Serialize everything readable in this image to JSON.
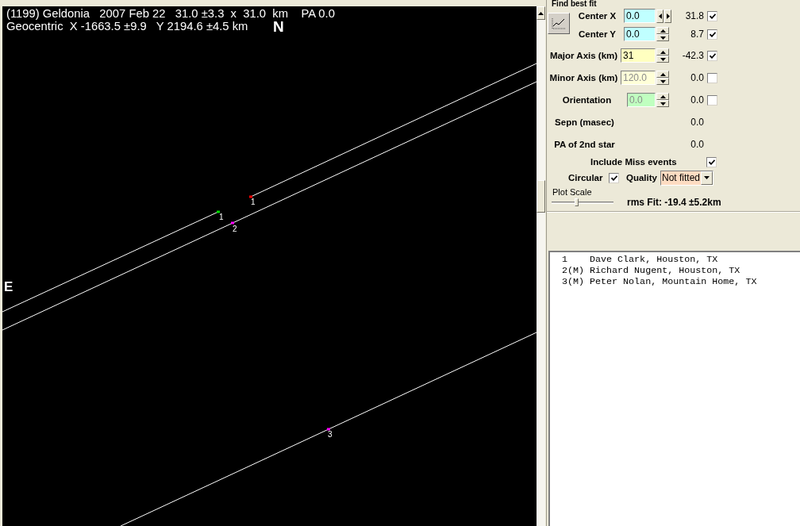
{
  "plot": {
    "header_lines": [
      "(1199) Geldonia   2007 Feb 22   31.0 ±3.3  x  31.0  km    PA 0.0",
      "Geocentric  X -1663.5 ±9.9   Y 2194.6 ±4.5 km"
    ],
    "north_label": "N",
    "east_label": "E",
    "events": [
      {
        "label": "1",
        "color": "#ff0000"
      },
      {
        "label": "1",
        "color": "#00e000"
      },
      {
        "label": "2",
        "color": "#ff00ff"
      },
      {
        "label": "3",
        "color": "#ff00ff"
      }
    ]
  },
  "fit_panel": {
    "title": "Find best fit",
    "parameters": [
      {
        "label": "Center X",
        "value": "0.0",
        "color": "#c0ffff",
        "disabled": false,
        "kind": "horizontal",
        "result": "31.8",
        "checked": true
      },
      {
        "label": "Center Y",
        "value": "0.0",
        "color": "#c0ffff",
        "disabled": false,
        "kind": "vertical",
        "result": "8.7",
        "checked": true
      },
      {
        "label": "Major Axis (km)",
        "value": "31",
        "color": "#ffffc0",
        "disabled": false,
        "kind": "vertical",
        "result": "-42.3",
        "checked": true
      },
      {
        "label": "Minor Axis (km)",
        "value": "120.0",
        "color": "#ffffd8",
        "disabled": true,
        "kind": "vertical",
        "result": "0.0",
        "checked": false
      },
      {
        "label": "Orientation",
        "value": "0.0",
        "color": "#c0ffc0",
        "disabled": true,
        "kind": "vertical",
        "result": "0.0",
        "checked": false
      }
    ],
    "readouts": [
      {
        "label": "Sepn (masec)",
        "value": "0.0"
      },
      {
        "label": "PA of 2nd star",
        "value": "0.0"
      }
    ],
    "include_miss": {
      "label": "Include Miss events",
      "checked": true
    },
    "circular": {
      "label": "Circular",
      "checked": true
    },
    "quality": {
      "label": "Quality",
      "value": "Not fitted"
    },
    "plot_scale": {
      "label": "Plot Scale",
      "level": 0.4
    },
    "rms_fit": "rms Fit: -19.4 ±5.2km"
  },
  "observers": [
    {
      "number": "1",
      "name": "Dave Clark, Houston, TX"
    },
    {
      "number": "2(M)",
      "name": "Richard Nugent, Houston, TX"
    },
    {
      "number": "3(M)",
      "name": "Peter Nolan, Mountain Home, TX"
    }
  ]
}
